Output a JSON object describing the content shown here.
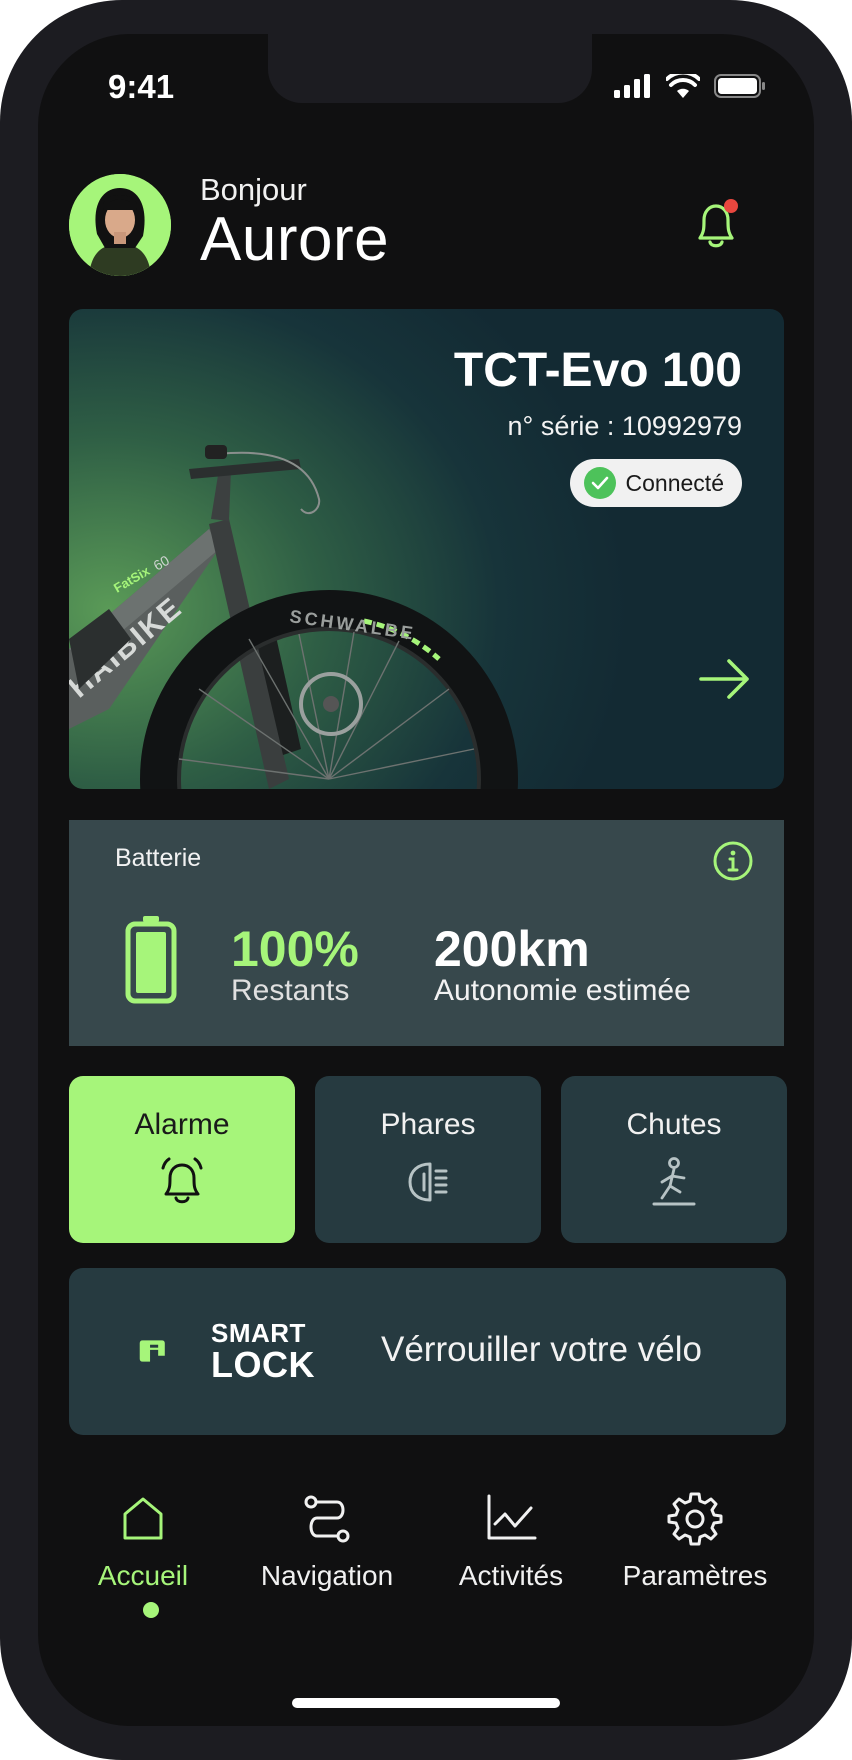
{
  "status_bar": {
    "time": "9:41"
  },
  "header": {
    "greeting": "Bonjour",
    "name": "Aurore"
  },
  "bike": {
    "model": "TCT-Evo 100",
    "serial": "n° série : 10992979",
    "status": "Connecté"
  },
  "battery": {
    "title": "Batterie",
    "percent": "100%",
    "percent_label": "Restants",
    "range": "200km",
    "range_label": "Autonomie estimée"
  },
  "features": [
    {
      "label": "Alarme",
      "icon": "bell-icon",
      "active": true
    },
    {
      "label": "Phares",
      "icon": "headlight-icon",
      "active": false
    },
    {
      "label": "Chutes",
      "icon": "fall-detection-icon",
      "active": false
    }
  ],
  "smart_lock": {
    "brand_line1": "SMART",
    "brand_line2": "LOCK",
    "action": "Vérrouiller votre vélo"
  },
  "nav": [
    {
      "label": "Accueil",
      "icon": "home-icon",
      "active": true
    },
    {
      "label": "Navigation",
      "icon": "route-icon",
      "active": false
    },
    {
      "label": "Activités",
      "icon": "chart-icon",
      "active": false
    },
    {
      "label": "Paramètres",
      "icon": "gear-icon",
      "active": false
    }
  ],
  "colors": {
    "accent": "#a6f57a",
    "background": "#101011",
    "card": "#263a40",
    "battery_card": "#37484c",
    "notification": "#e8473f",
    "connected": "#4dc25a"
  }
}
